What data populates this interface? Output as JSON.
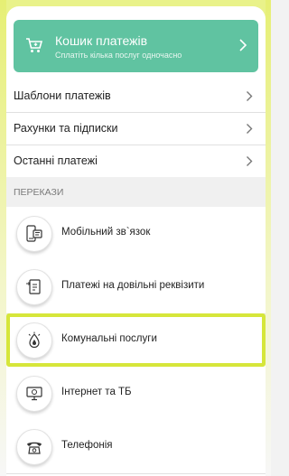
{
  "colors": {
    "cart_background": "#60c3a1",
    "highlight_border": "#d6e63a",
    "frame_tint": "#e9f28a"
  },
  "cart": {
    "title": "Кошик платежів",
    "subtitle": "Сплатіть кілька послуг одночасно",
    "icon": "cart-icon"
  },
  "menu": [
    {
      "label": "Шаблони платежів"
    },
    {
      "label": "Рахунки та підписки"
    },
    {
      "label": "Останні платежі"
    }
  ],
  "section_title": "ПЕРЕКАЗИ",
  "services": [
    {
      "label": "Мобільний зв`язок",
      "icon": "mobile-phone-icon"
    },
    {
      "label": "Платежі на довільні реквізити",
      "icon": "document-icon"
    },
    {
      "label": "Комунальні послуги",
      "icon": "utilities-icon",
      "highlighted": true
    },
    {
      "label": "Інтернет та ТБ",
      "icon": "computer-icon"
    },
    {
      "label": "Телефонія",
      "icon": "telephone-icon"
    }
  ]
}
